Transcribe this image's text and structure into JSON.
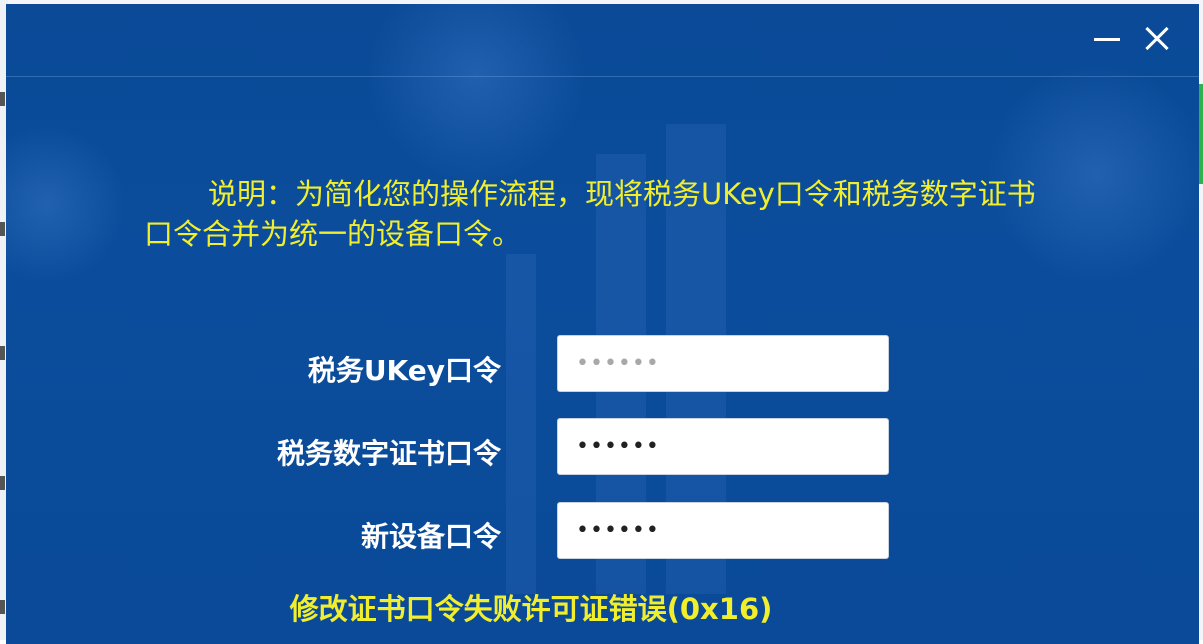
{
  "window": {
    "minimize_icon": "minimize-icon",
    "close_icon": "close-icon"
  },
  "notice": {
    "text": "说明：为简化您的操作流程，现将税务UKey口令和税务数字证书口令合并为统一的设备口令。"
  },
  "form": {
    "fields": [
      {
        "label": "税务UKey口令",
        "value": "••••••",
        "state": "placeholder"
      },
      {
        "label": "税务数字证书口令",
        "value": "••••••",
        "state": "filled"
      },
      {
        "label": "新设备口令",
        "value": "••••••",
        "state": "filled"
      }
    ]
  },
  "status": {
    "error_text": "修改证书口令失败许可证错误(0x16)"
  },
  "colors": {
    "dialog_bg": "#0b4d9c",
    "notice_text": "#f1ee2e",
    "label_text": "#ffffff"
  }
}
